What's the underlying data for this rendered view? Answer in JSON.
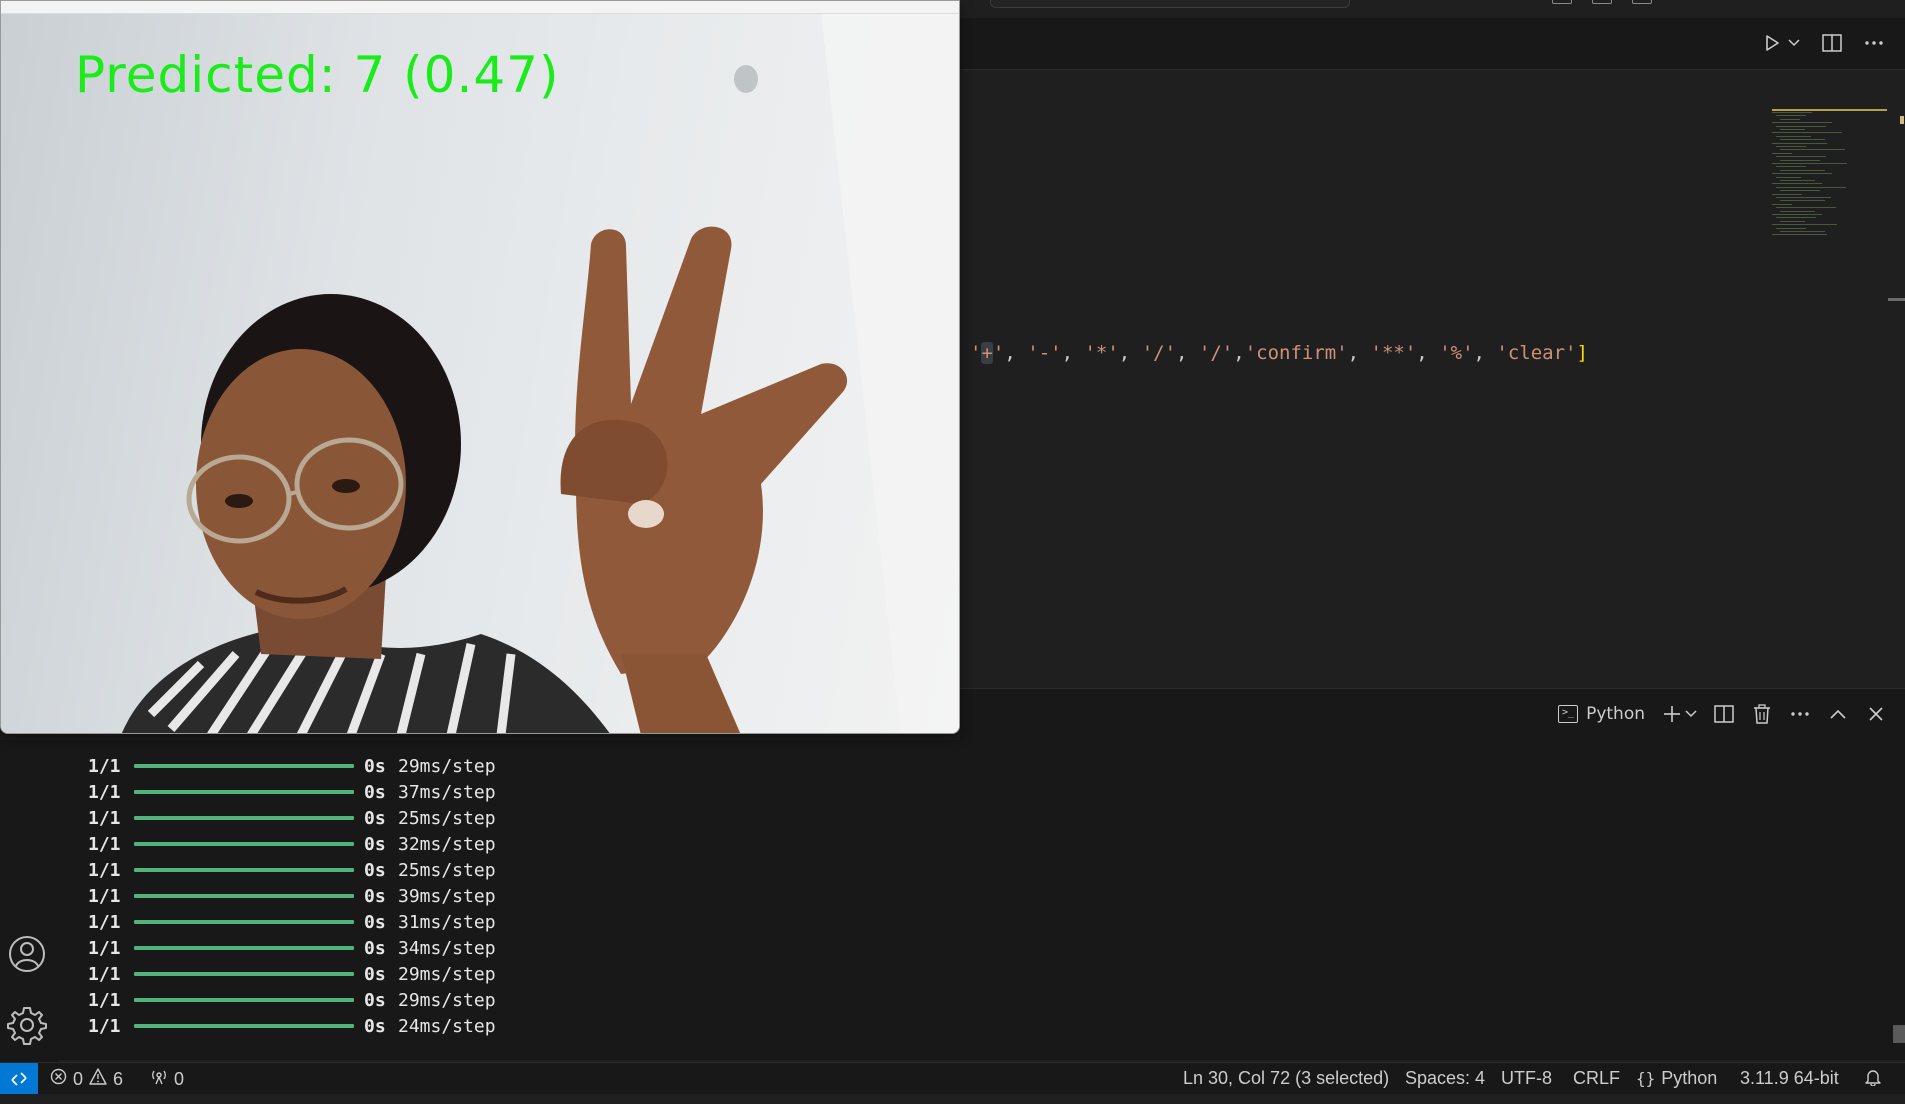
{
  "camera": {
    "prediction_text": "Predicted: 7 (0.47)",
    "text_color": "#19ec19"
  },
  "editor": {
    "code_tokens": [
      {
        "t": "'",
        "k": "str"
      },
      {
        "t": "+",
        "k": "str-sel"
      },
      {
        "t": "'",
        "k": "str"
      },
      {
        "t": ", ",
        "k": "punc"
      },
      {
        "t": "'-'",
        "k": "str"
      },
      {
        "t": ", ",
        "k": "punc"
      },
      {
        "t": "'*'",
        "k": "str"
      },
      {
        "t": ", ",
        "k": "punc"
      },
      {
        "t": "'/'",
        "k": "str"
      },
      {
        "t": ", ",
        "k": "punc"
      },
      {
        "t": "'/'",
        "k": "str"
      },
      {
        "t": ",",
        "k": "punc"
      },
      {
        "t": "'confirm'",
        "k": "str"
      },
      {
        "t": ", ",
        "k": "punc"
      },
      {
        "t": "'**'",
        "k": "str"
      },
      {
        "t": ", ",
        "k": "punc"
      },
      {
        "t": "'%'",
        "k": "str"
      },
      {
        "t": ", ",
        "k": "punc"
      },
      {
        "t": "'clear'",
        "k": "str"
      },
      {
        "t": "]",
        "k": "br"
      }
    ],
    "actions": [
      "run-icon",
      "chevron-down-icon",
      "split-editor-icon",
      "more-icon"
    ]
  },
  "panel": {
    "terminal_label": "Python",
    "actions": [
      "new-terminal-icon",
      "chevron-down-icon",
      "split-terminal-icon",
      "trash-icon",
      "more-icon",
      "maximize-panel-icon",
      "close-panel-icon"
    ]
  },
  "terminal": {
    "rows": [
      {
        "frac": "1/1",
        "sec": "0s",
        "step": "29ms/step"
      },
      {
        "frac": "1/1",
        "sec": "0s",
        "step": "37ms/step"
      },
      {
        "frac": "1/1",
        "sec": "0s",
        "step": "25ms/step"
      },
      {
        "frac": "1/1",
        "sec": "0s",
        "step": "32ms/step"
      },
      {
        "frac": "1/1",
        "sec": "0s",
        "step": "25ms/step"
      },
      {
        "frac": "1/1",
        "sec": "0s",
        "step": "39ms/step"
      },
      {
        "frac": "1/1",
        "sec": "0s",
        "step": "31ms/step"
      },
      {
        "frac": "1/1",
        "sec": "0s",
        "step": "34ms/step"
      },
      {
        "frac": "1/1",
        "sec": "0s",
        "step": "29ms/step"
      },
      {
        "frac": "1/1",
        "sec": "0s",
        "step": "29ms/step"
      },
      {
        "frac": "1/1",
        "sec": "0s",
        "step": "24ms/step"
      }
    ],
    "bar_color": "#4fb37b"
  },
  "status": {
    "errors": "0",
    "warnings": "6",
    "ports": "0",
    "cursor": "Ln 30, Col 72 (3 selected)",
    "spaces": "Spaces: 4",
    "encoding": "UTF-8",
    "eol": "CRLF",
    "language": "Python",
    "interpreter": "3.11.9 64-bit",
    "remote_color": "#0078d4"
  }
}
